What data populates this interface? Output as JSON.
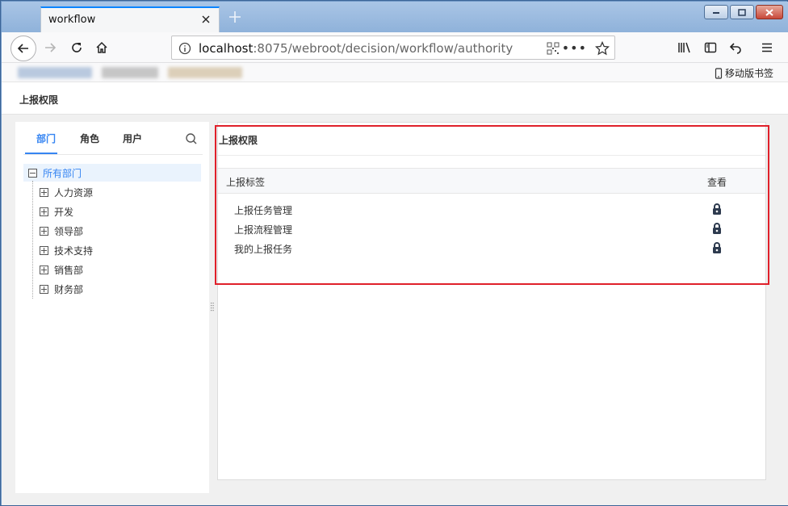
{
  "browser": {
    "tab_title": "workflow",
    "url_host": "localhost",
    "url_rest": ":8075/webroot/decision/workflow/authority",
    "url_dots": "•••",
    "mobile_bookmarks": "移动版书签"
  },
  "page": {
    "title": "上报权限"
  },
  "left_panel": {
    "tabs": [
      {
        "label": "部门",
        "active": true
      },
      {
        "label": "角色",
        "active": false
      },
      {
        "label": "用户",
        "active": false
      }
    ],
    "tree": {
      "root": "所有部门",
      "children": [
        "人力资源",
        "开发",
        "领导部",
        "技术支持",
        "销售部",
        "财务部"
      ]
    }
  },
  "right_panel": {
    "title": "上报权限",
    "columns": {
      "label": "上报标签",
      "view": "查看"
    },
    "rows": [
      "上报任务管理",
      "上报流程管理",
      "我的上报任务"
    ]
  },
  "colors": {
    "accent": "#3685f2",
    "highlight": "#e0202a"
  }
}
